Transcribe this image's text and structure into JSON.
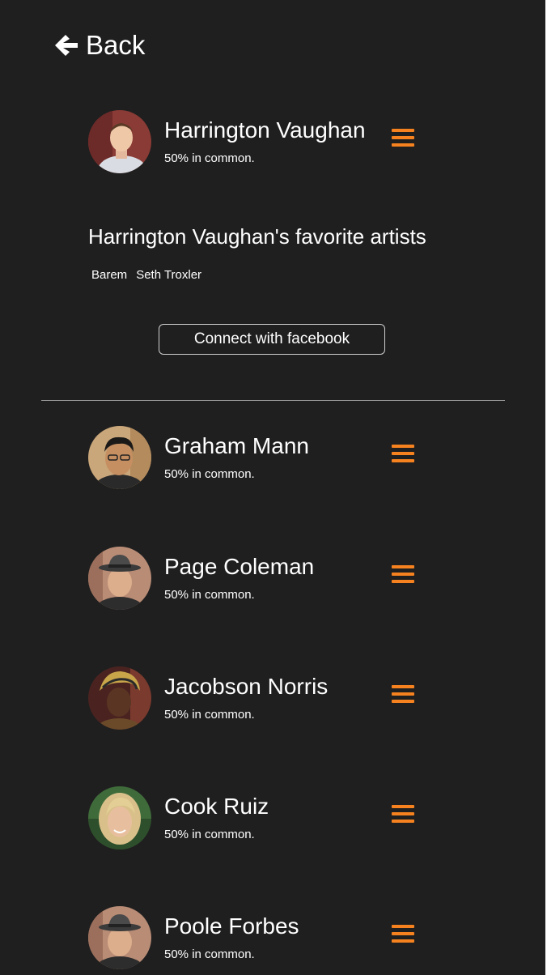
{
  "header": {
    "back_label": "Back",
    "back_icon": "arrow-left-icon"
  },
  "colors": {
    "background": "#1f1f1f",
    "accent_orange": "#f5821f",
    "text": "#ffffff"
  },
  "profile": {
    "name": "Harrington Vaughan",
    "common": "50% in common.",
    "favorites_title": "Harrington Vaughan's favorite artists",
    "artists": [
      "Barem",
      "Seth Troxler"
    ],
    "connect_label": "Connect with facebook",
    "menu_icon": "hamburger-menu-icon"
  },
  "users": [
    {
      "name": "Graham Mann",
      "common": "50% in common."
    },
    {
      "name": "Page Coleman",
      "common": "50% in common."
    },
    {
      "name": "Jacobson Norris",
      "common": "50% in common."
    },
    {
      "name": "Cook Ruiz",
      "common": "50% in common."
    },
    {
      "name": "Poole Forbes",
      "common": "50% in common."
    }
  ]
}
